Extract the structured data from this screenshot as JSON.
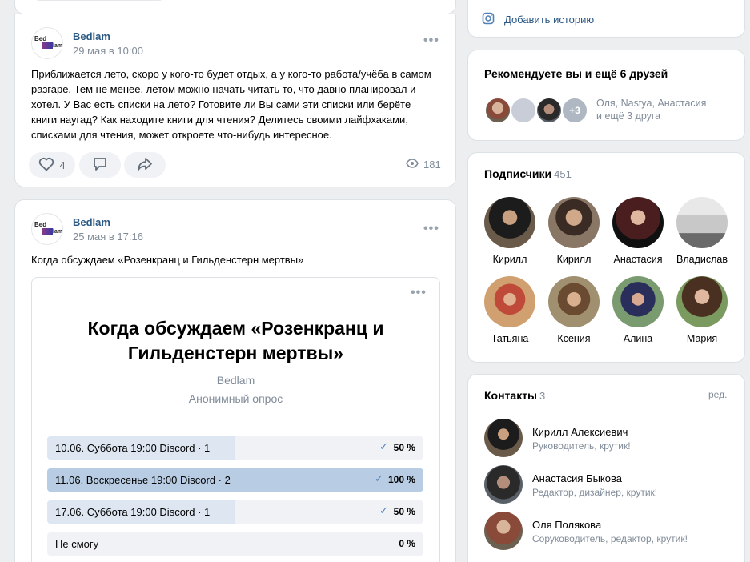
{
  "post1": {
    "author": "Bedlam",
    "date": "29 мая в 10:00",
    "text_lines": [
      "Приближается лето, скоро у кого-то будет отдых, а у кого-то работа/учёба в самом",
      "разгаре. Тем не менее, летом можно начать читать то, что давно планировал и",
      "хотел. У Вас есть списки на лето? Готовите ли Вы сами эти списки или берёте",
      "книги наугад? Как находите книги для чтения? Делитесь своими лайфхаками,",
      "списками для чтения, может откроете что-нибудь интересное."
    ],
    "likes": "4",
    "views": "181"
  },
  "post2": {
    "author": "Bedlam",
    "date": "25 мая в 17:16",
    "text": "Когда обсуждаем «Розенкранц и Гильденстерн мертвы»",
    "poll": {
      "title_line1": "Когда обсуждаем «Розенкранц и",
      "title_line2": "Гильденстерн мертвы»",
      "author": "Bedlam",
      "type": "Анонимный опрос",
      "options": [
        {
          "label": "10.06. Суббота 19:00 Discord · 1",
          "percent": "50 %",
          "fraction": 0.5,
          "voted": true
        },
        {
          "label": "11.06. Воскресенье 19:00 Discord · 2",
          "percent": "100 %",
          "fraction": 1.0,
          "voted": true
        },
        {
          "label": "17.06. Суббота 19:00 Discord · 1",
          "percent": "50 %",
          "fraction": 0.5,
          "voted": true
        },
        {
          "label": "Не смогу",
          "percent": "0 %",
          "fraction": 0,
          "voted": false
        }
      ]
    }
  },
  "story": {
    "label": "Добавить историю"
  },
  "recommend": {
    "title": "Рекомендуете вы и ещё 6 друзей",
    "more_badge": "+3",
    "names_line1": "Оля, Nastya, Анастасия",
    "names_line2": "и ещё 3 друга"
  },
  "subscribers": {
    "title": "Подписчики",
    "count": "451",
    "items": [
      {
        "name": "Кирилл"
      },
      {
        "name": "Кирилл"
      },
      {
        "name": "Анастасия"
      },
      {
        "name": "Владислав"
      },
      {
        "name": "Татьяна"
      },
      {
        "name": "Ксения"
      },
      {
        "name": "Алина"
      },
      {
        "name": "Мария"
      }
    ]
  },
  "contacts": {
    "title": "Контакты",
    "count": "3",
    "edit": "ред.",
    "items": [
      {
        "name": "Кирилл Алексиевич",
        "role": "Руководитель, крутик!"
      },
      {
        "name": "Анастасия Быкова",
        "role": "Редактор, дизайнер, крутик!"
      },
      {
        "name": "Оля Полякова",
        "role": "Соруководитель, редактор, крутик!"
      }
    ]
  },
  "colors": {
    "link": "#2a5885",
    "accent": "#5181b8",
    "bg": "#edeef0"
  }
}
